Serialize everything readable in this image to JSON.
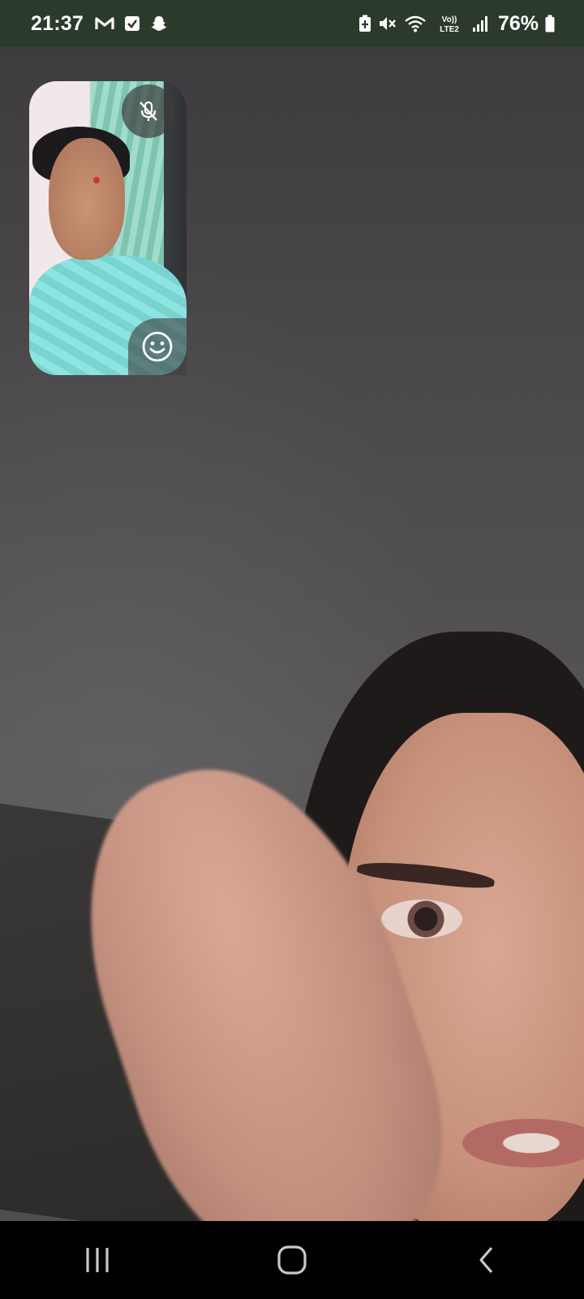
{
  "status_bar": {
    "time": "21:37",
    "battery_percent": "76%",
    "network_label": "Vo)) LTE2",
    "left_icons": [
      "gmail-icon",
      "checkbox-icon",
      "snapchat-icon"
    ],
    "right_icons": [
      "battery-saver-icon",
      "mute-icon",
      "wifi-icon",
      "volte-icon",
      "signal-icon",
      "battery-icon"
    ]
  },
  "call": {
    "self_preview": {
      "mute_icon": "mic-off-icon",
      "effects_icon": "smiley-icon"
    }
  },
  "nav_bar": {
    "buttons": [
      "recents-icon",
      "home-icon",
      "back-icon"
    ]
  },
  "colors": {
    "status_bar_bg": "#2b3a2a",
    "nav_bar_bg": "#000000"
  }
}
